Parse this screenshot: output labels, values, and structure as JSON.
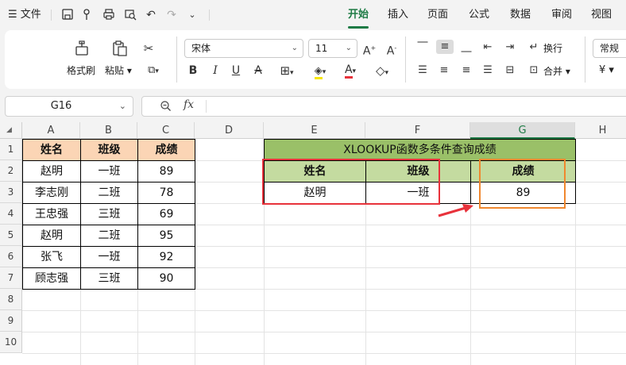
{
  "menubar": {
    "file": "文件",
    "tabs": [
      "开始",
      "插入",
      "页面",
      "公式",
      "数据",
      "审阅",
      "视图"
    ]
  },
  "ribbon": {
    "format_painter": "格式刷",
    "paste": "粘贴",
    "font_name": "宋体",
    "font_size": "11",
    "wrap": "换行",
    "merge": "合并",
    "number_format": "常规",
    "currency": "¥"
  },
  "formula_bar": {
    "cell_ref": "G16",
    "fx": "fx",
    "content": ""
  },
  "columns": [
    "A",
    "B",
    "C",
    "D",
    "E",
    "F",
    "G",
    "H"
  ],
  "rows": [
    "1",
    "2",
    "3",
    "4",
    "5",
    "6",
    "7",
    "8",
    "9",
    "10"
  ],
  "table1": {
    "headers": [
      "姓名",
      "班级",
      "成绩"
    ],
    "rows": [
      [
        "赵明",
        "一班",
        "89"
      ],
      [
        "李志刚",
        "二班",
        "78"
      ],
      [
        "王忠强",
        "三班",
        "69"
      ],
      [
        "赵明",
        "二班",
        "95"
      ],
      [
        "张飞",
        "一班",
        "92"
      ],
      [
        "顾志强",
        "三班",
        "90"
      ]
    ]
  },
  "table2": {
    "title": "XLOOKUP函数多条件查询成绩",
    "headers": [
      "姓名",
      "班级",
      "成绩"
    ],
    "values": [
      "赵明",
      "一班",
      "89"
    ]
  },
  "colors": {
    "accent": "#1e7b45",
    "peach_header": "#fbd5b5",
    "title_green": "#9ac068",
    "header_green": "#c4dba0",
    "red_highlight": "#e8323b",
    "orange_highlight": "#f0872e"
  }
}
